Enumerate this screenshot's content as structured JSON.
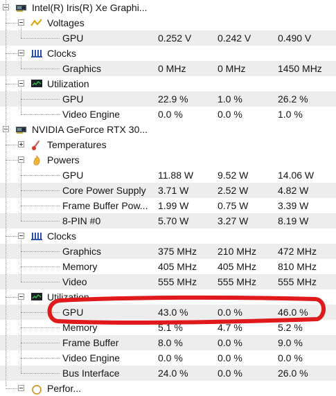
{
  "tree": [
    {
      "type": "device",
      "label": "Intel(R) Iris(R) Xe Graphi...",
      "icon": "gpu-card-icon",
      "level": 0
    },
    {
      "type": "category",
      "label": "Voltages",
      "icon": "voltage-icon",
      "level": 1
    },
    {
      "type": "sensor",
      "label": "GPU",
      "values": [
        "0.252 V",
        "0.242 V",
        "0.490 V"
      ],
      "level": 2
    },
    {
      "type": "category",
      "label": "Clocks",
      "icon": "clock-bars-icon",
      "level": 1
    },
    {
      "type": "sensor",
      "label": "Graphics",
      "values": [
        "0 MHz",
        "0 MHz",
        "1450 MHz"
      ],
      "level": 2
    },
    {
      "type": "category",
      "label": "Utilization",
      "icon": "monitor-icon",
      "level": 1
    },
    {
      "type": "sensor",
      "label": "GPU",
      "values": [
        "22.9 %",
        "1.0 %",
        "26.2 %"
      ],
      "level": 2
    },
    {
      "type": "sensor",
      "label": "Video Engine",
      "values": [
        "0.0 %",
        "0.0 %",
        "1.0 %"
      ],
      "level": 2
    },
    {
      "type": "device",
      "label": "NVIDIA GeForce RTX 30...",
      "icon": "gpu-card-icon",
      "level": 0
    },
    {
      "type": "category",
      "label": "Temperatures",
      "icon": "thermometer-icon",
      "level": 1,
      "collapsed": true
    },
    {
      "type": "category",
      "label": "Powers",
      "icon": "power-flame-icon",
      "level": 1
    },
    {
      "type": "sensor",
      "label": "GPU",
      "values": [
        "11.88 W",
        "9.52 W",
        "14.06 W"
      ],
      "level": 2
    },
    {
      "type": "sensor",
      "label": "Core Power Supply",
      "values": [
        "3.71 W",
        "2.52 W",
        "4.82 W"
      ],
      "level": 2
    },
    {
      "type": "sensor",
      "label": "Frame Buffer Pow...",
      "values": [
        "1.99 W",
        "0.75 W",
        "3.39 W"
      ],
      "level": 2
    },
    {
      "type": "sensor",
      "label": "8-PIN #0",
      "values": [
        "5.70 W",
        "3.27 W",
        "8.19 W"
      ],
      "level": 2
    },
    {
      "type": "category",
      "label": "Clocks",
      "icon": "clock-bars-icon",
      "level": 1
    },
    {
      "type": "sensor",
      "label": "Graphics",
      "values": [
        "375 MHz",
        "210 MHz",
        "472 MHz"
      ],
      "level": 2
    },
    {
      "type": "sensor",
      "label": "Memory",
      "values": [
        "405 MHz",
        "405 MHz",
        "810 MHz"
      ],
      "level": 2
    },
    {
      "type": "sensor",
      "label": "Video",
      "values": [
        "555 MHz",
        "555 MHz",
        "555 MHz"
      ],
      "level": 2
    },
    {
      "type": "category",
      "label": "Utilization",
      "icon": "monitor-icon",
      "level": 1
    },
    {
      "type": "sensor",
      "label": "GPU",
      "values": [
        "43.0 %",
        "0.0 %",
        "46.0 %"
      ],
      "level": 2,
      "highlighted": true
    },
    {
      "type": "sensor",
      "label": "Memory",
      "values": [
        "5.1 %",
        "4.7 %",
        "5.2 %"
      ],
      "level": 2
    },
    {
      "type": "sensor",
      "label": "Frame Buffer",
      "values": [
        "8.0 %",
        "0.0 %",
        "9.0 %"
      ],
      "level": 2
    },
    {
      "type": "sensor",
      "label": "Video Engine",
      "values": [
        "0.0 %",
        "0.0 %",
        "0.0 %"
      ],
      "level": 2
    },
    {
      "type": "sensor",
      "label": "Bus Interface",
      "values": [
        "24.0 %",
        "0.0 %",
        "26.0 %"
      ],
      "level": 2
    },
    {
      "type": "category",
      "label": "Perfor...",
      "icon": "performance-icon",
      "level": 1,
      "partial": true
    }
  ],
  "colors": {
    "shaded_row": "#ededed",
    "highlight_annotation": "#e0191c",
    "tree_lines": "#9a9a9a"
  }
}
